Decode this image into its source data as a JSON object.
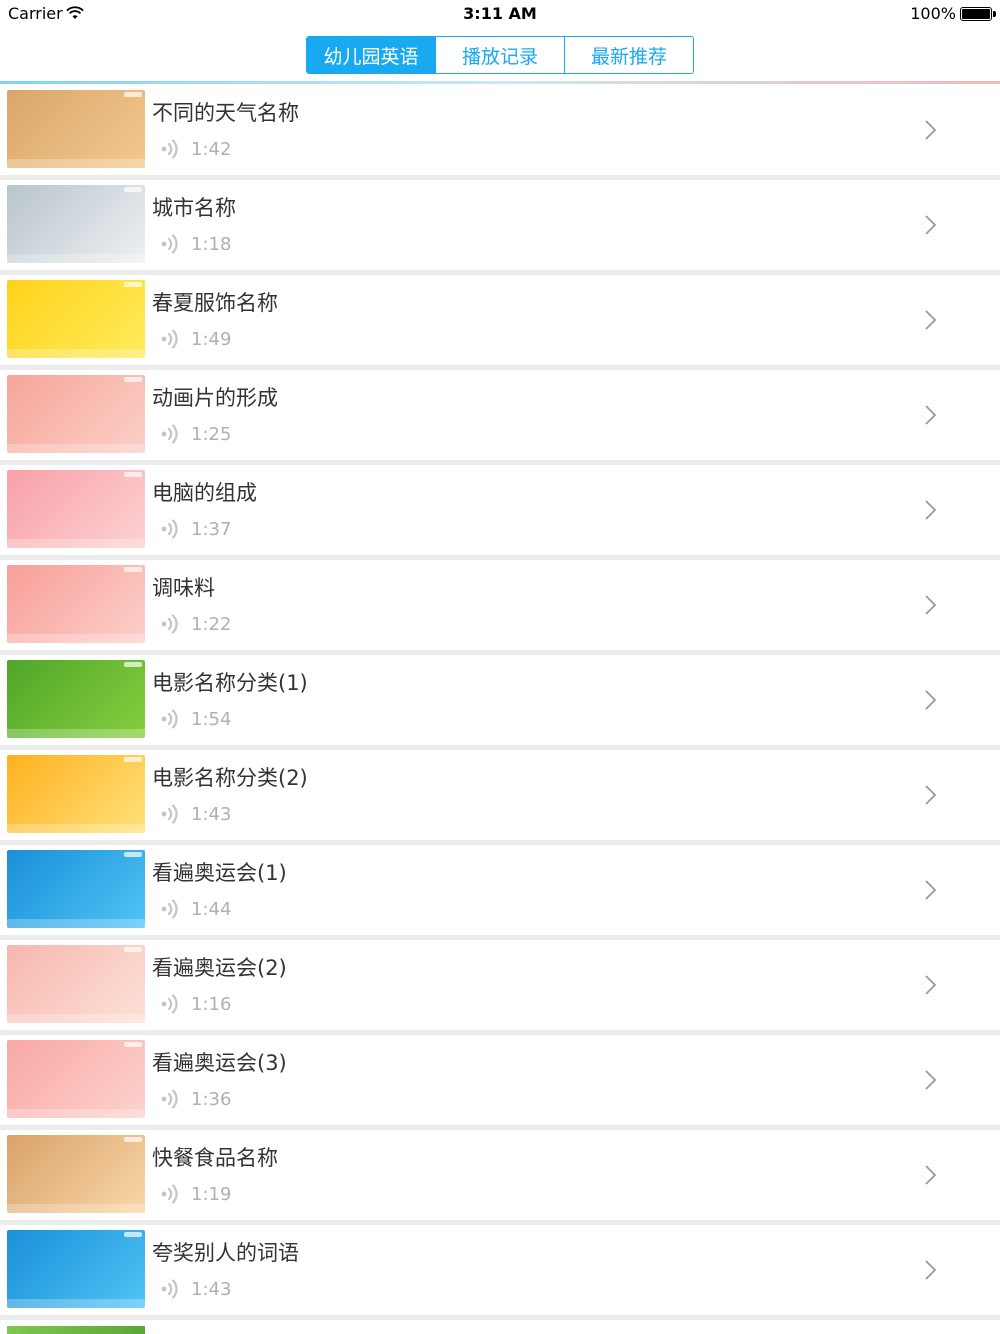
{
  "status_bar": {
    "carrier": "Carrier",
    "time": "3:11 AM",
    "battery": "100%"
  },
  "tabs": [
    {
      "label": "幼儿园英语",
      "active": true
    },
    {
      "label": "播放记录",
      "active": false
    },
    {
      "label": "最新推荐",
      "active": false
    }
  ],
  "colors": {
    "accent": "#19a9f0",
    "title": "#333333",
    "duration": "#b0b0b0",
    "separator": "#ececec"
  },
  "items": [
    {
      "title": "不同的天气名称",
      "duration": "1:42",
      "thumb_colors": [
        "#d9a66a",
        "#f4c98e"
      ]
    },
    {
      "title": "城市名称",
      "duration": "1:18",
      "thumb_colors": [
        "#b9c4cc",
        "#eef1f3"
      ]
    },
    {
      "title": "春夏服饰名称",
      "duration": "1:49",
      "thumb_colors": [
        "#ffd21a",
        "#ffec5c"
      ]
    },
    {
      "title": "动画片的形成",
      "duration": "1:25",
      "thumb_colors": [
        "#f7a59a",
        "#fbd0c7"
      ]
    },
    {
      "title": "电脑的组成",
      "duration": "1:37",
      "thumb_colors": [
        "#f9a0a8",
        "#fdd2d3"
      ]
    },
    {
      "title": "调味料",
      "duration": "1:22",
      "thumb_colors": [
        "#f99e98",
        "#fcd0cb"
      ]
    },
    {
      "title": "电影名称分类(1)",
      "duration": "1:54",
      "thumb_colors": [
        "#4fa629",
        "#86cf3d"
      ]
    },
    {
      "title": "电影名称分类(2)",
      "duration": "1:43",
      "thumb_colors": [
        "#ffb11f",
        "#ffe27a"
      ]
    },
    {
      "title": "看遍奥运会(1)",
      "duration": "1:44",
      "thumb_colors": [
        "#1a8fd8",
        "#4fc4f5"
      ]
    },
    {
      "title": "看遍奥运会(2)",
      "duration": "1:16",
      "thumb_colors": [
        "#f6b7b0",
        "#fde1d6"
      ]
    },
    {
      "title": "看遍奥运会(3)",
      "duration": "1:36",
      "thumb_colors": [
        "#f9a8a4",
        "#fdd3cd"
      ]
    },
    {
      "title": "快餐食品名称",
      "duration": "1:19",
      "thumb_colors": [
        "#d9a26a",
        "#f8d8a8"
      ]
    },
    {
      "title": "夸奖别人的词语",
      "duration": "1:43",
      "thumb_colors": [
        "#1a8fd8",
        "#4fc4f5"
      ]
    }
  ]
}
